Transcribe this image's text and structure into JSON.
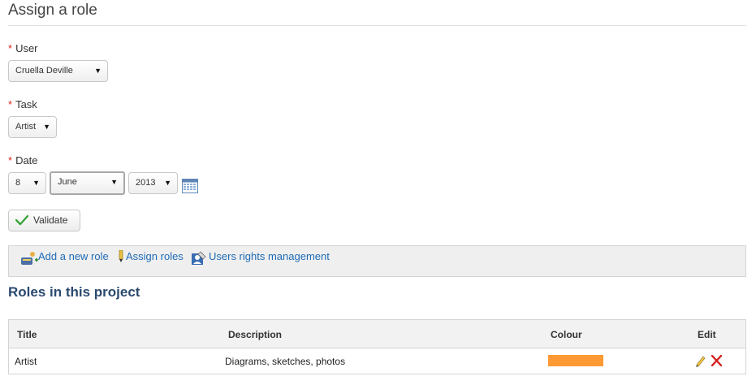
{
  "page": {
    "title": "Assign a role"
  },
  "form": {
    "required_mark": "*",
    "user": {
      "label": "User",
      "value": "Cruella Deville"
    },
    "task": {
      "label": "Task",
      "value": "Artist"
    },
    "date": {
      "label": "Date",
      "day": "8",
      "month": "June",
      "year": "2013"
    },
    "validate_label": "Validate"
  },
  "toolbar": {
    "add_role": "Add a new role",
    "assign_roles": "Assign roles",
    "user_rights": "Users rights management"
  },
  "roles": {
    "title": "Roles in this project",
    "columns": {
      "title": "Title",
      "description": "Description",
      "colour": "Colour",
      "edit": "Edit"
    },
    "rows": [
      {
        "title": "Artist",
        "description": "Diagrams, sketches, photos",
        "colour": "#ff9933"
      }
    ]
  },
  "colors": {
    "link": "#1e6bb8",
    "required": "#d9271e",
    "section_title": "#2b4a6f"
  }
}
